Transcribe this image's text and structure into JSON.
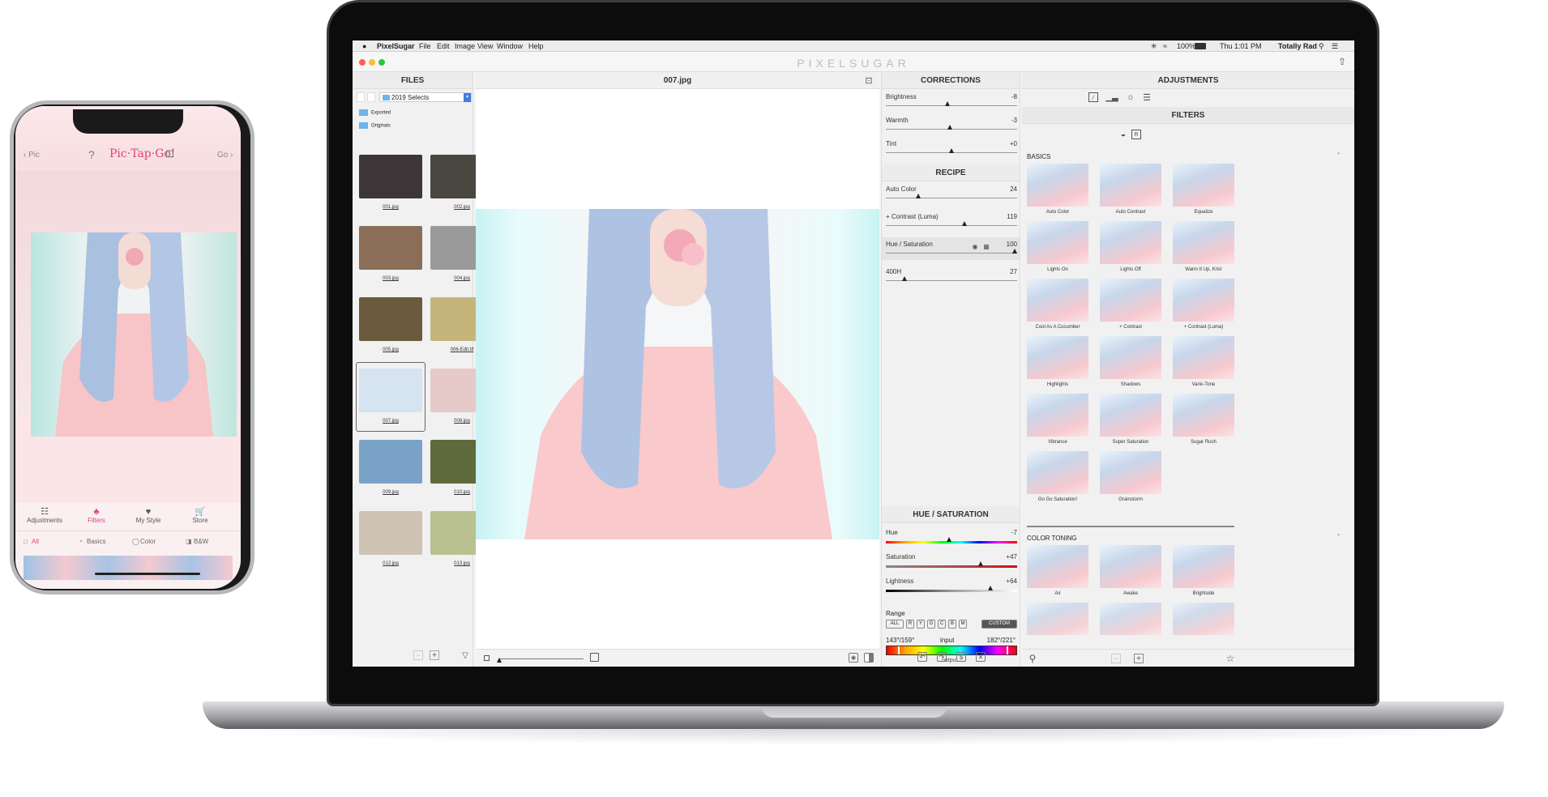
{
  "menubar": {
    "apple_icon": "apple-icon",
    "app": "PixelSugar",
    "items": [
      "File",
      "Edit",
      "Image",
      "View",
      "Window",
      "Help"
    ],
    "battery": "100%",
    "time": "Thu 1:01 PM",
    "user": "Totally Rad"
  },
  "brand": "PIXELSUGAR",
  "files": {
    "title": "FILES",
    "folder": "2019 Selects",
    "subfolders": [
      "Exported",
      "Originals"
    ],
    "thumbs": [
      {
        "name": "001.jpg",
        "color": "#3c3638"
      },
      {
        "name": "002.jpg",
        "color": "#4a4640"
      },
      {
        "name": "003.jpg",
        "color": "#8a6e57"
      },
      {
        "name": "004.jpg",
        "color": "#9a9a9a"
      },
      {
        "name": "005.jpg",
        "color": "#6b5a3e"
      },
      {
        "name": "006-Edit.tif",
        "color": "#c6b57a"
      },
      {
        "name": "007.jpg",
        "color": "#d6e3f0"
      },
      {
        "name": "008.jpg",
        "color": "#e6c9c9"
      },
      {
        "name": "009.jpg",
        "color": "#7aa2c9"
      },
      {
        "name": "010.jpg",
        "color": "#5f6a3c"
      },
      {
        "name": "012.jpg",
        "color": "#cfc3b3"
      },
      {
        "name": "013.jpg",
        "color": "#b9c190"
      }
    ]
  },
  "viewer": {
    "title": "007.jpg"
  },
  "corrections": {
    "title": "CORRECTIONS",
    "sliders": [
      {
        "label": "Brightness",
        "value": "-8",
        "pos": 0.47
      },
      {
        "label": "Warmth",
        "value": "-3",
        "pos": 0.49
      },
      {
        "label": "Tint",
        "value": "+0",
        "pos": 0.5
      }
    ]
  },
  "recipe": {
    "title": "RECIPE",
    "items": [
      {
        "label": "Auto Color",
        "value": "24",
        "pos": 0.24
      },
      {
        "label": "+ Contrast (Luma)",
        "value": "119",
        "pos": 0.6
      },
      {
        "label": "Hue / Saturation",
        "value": "100",
        "pos": 1.0
      },
      {
        "label": "400H",
        "value": "27",
        "pos": 0.13
      }
    ]
  },
  "huesat": {
    "title": "HUE / SATURATION",
    "sliders": [
      {
        "label": "Hue",
        "value": "-7",
        "pos": 0.48
      },
      {
        "label": "Saturation",
        "value": "+47",
        "pos": 0.73
      },
      {
        "label": "Lightness",
        "value": "+64",
        "pos": 0.81
      }
    ],
    "range_label": "Range",
    "range_buttons": [
      "ALL",
      "R",
      "Y",
      "G",
      "C",
      "B",
      "M",
      "CUSTOM"
    ],
    "range_left": "143°/159°",
    "range_mid": "input",
    "range_right": "182°/221°",
    "output_label": "output"
  },
  "adjustments": {
    "title": "ADJUSTMENTS",
    "filters_title": "FILTERS",
    "basics_title": "BASICS",
    "toning_title": "COLOR TONING",
    "basics": [
      "Auto Color",
      "Auto Contrast",
      "Equalize",
      "Lights On",
      "Lights Off",
      "Warm It Up, Kris!",
      "Cool As A Cucumber",
      "+ Contrast",
      "+ Contrast (Luma)",
      "Highlights",
      "Shadows",
      "Vario-Tone",
      "Vibrance",
      "Super Saturation",
      "Sugar Rush",
      "Go Go Saturation!",
      "Grainstorm"
    ],
    "toning": [
      "Air",
      "Awake",
      "Brightside"
    ]
  },
  "phone": {
    "back": "Pic",
    "logo": "Pic·Tap·Go!",
    "forward": "Go",
    "help": "?",
    "tabs": [
      "Adjustments",
      "Filters",
      "My Style",
      "Store"
    ],
    "filters": [
      "All",
      "Basics",
      "Color",
      "B&W"
    ]
  },
  "colors": {
    "accent": "#e0407a",
    "selected": "#444444"
  }
}
